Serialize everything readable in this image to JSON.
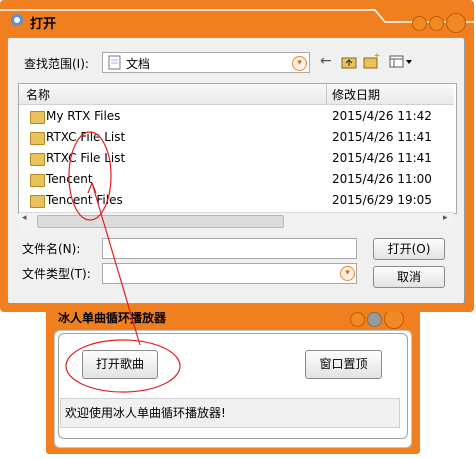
{
  "player": {
    "title": "冰人单曲循环播放器",
    "open_song_label": "打开歌曲",
    "pin_label": "窗口置顶",
    "status_text": "欢迎使用冰人单曲循环播放器!"
  },
  "dialog": {
    "title": "打开",
    "look_in_label": "查找范围(I):",
    "look_in_value": "文档",
    "columns": {
      "name": "名称",
      "date": "修改日期"
    },
    "files": [
      {
        "name": "My RTX Files",
        "date": "2015/4/26 11:42"
      },
      {
        "name": "RTXC File List",
        "date": "2015/4/26 11:41"
      },
      {
        "name": "RTXC File List",
        "date": "2015/4/26 11:41"
      },
      {
        "name": "Tencent",
        "date": "2015/4/26 11:00"
      },
      {
        "name": "Tencent Files",
        "date": "2015/6/29 19:05"
      }
    ],
    "filename_label": "文件名(N):",
    "filename_value": "",
    "filetype_label": "文件类型(T):",
    "filetype_value": "",
    "open_label": "打开(O)",
    "cancel_label": "取消"
  },
  "colors": {
    "window_frame": "#ef7f1f",
    "annotation": "#e02020"
  }
}
